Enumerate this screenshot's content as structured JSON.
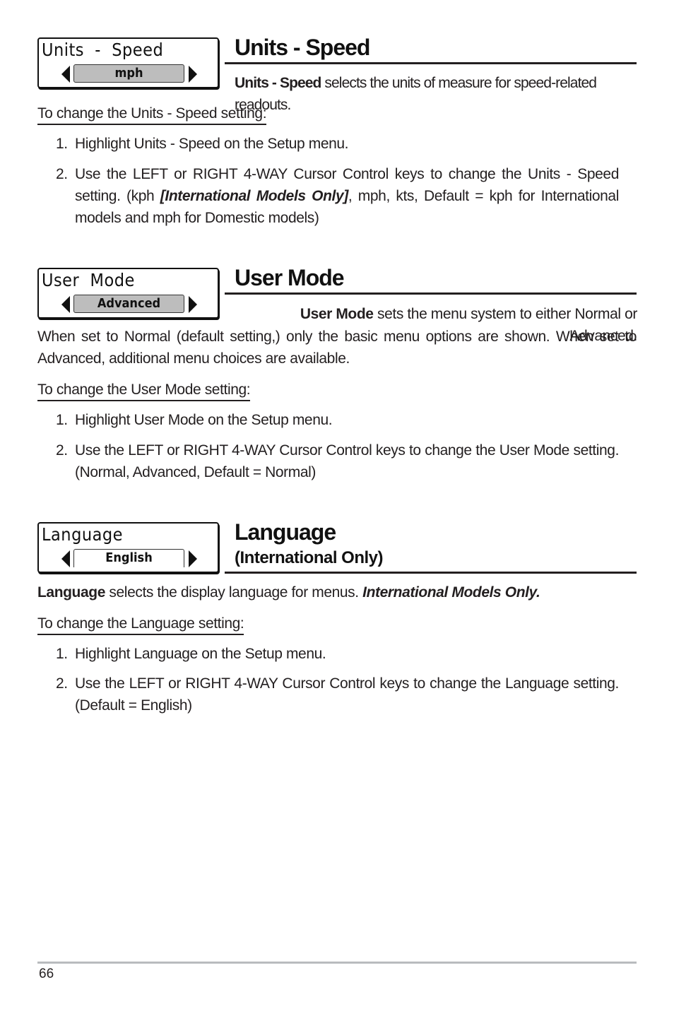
{
  "sections": [
    {
      "widget": {
        "label": "Units  -  Speed",
        "value": "mph",
        "left_arrow_icon": "triangle-left",
        "right_arrow_icon": "triangle-right"
      },
      "title": "Units - Speed",
      "intro_bold": "Units - Speed",
      "intro_rest": " selects the units of measure for speed-related readouts.",
      "procedure_heading": "To change the Units - Speed setting:",
      "steps": [
        {
          "num": "1.",
          "text": "Highlight Units - Speed on the Setup menu."
        },
        {
          "num": "2.",
          "text_before": "Use the LEFT or RIGHT 4-WAY Cursor Control keys to change the Units - Speed setting. (kph ",
          "text_italic": "[International Models Only]",
          "text_after": ", mph, kts, Default = kph for International models and mph for Domestic models)"
        }
      ]
    },
    {
      "widget": {
        "label": "User  Mode",
        "value": "Advanced",
        "left_arrow_icon": "triangle-left",
        "right_arrow_icon": "triangle-right"
      },
      "title": "User Mode",
      "intro_bold": "User Mode",
      "intro_rest": " sets the menu system to either Normal or Advanced.",
      "intro_continued": "When set to Normal (default setting,) only the basic menu options are shown.  When set to Advanced, additional menu choices are available.",
      "procedure_heading": "To change the User Mode setting:",
      "steps": [
        {
          "num": "1.",
          "text": "Highlight User Mode on the Setup menu."
        },
        {
          "num": "2.",
          "text": "Use the LEFT or RIGHT 4-WAY Cursor Control keys to change the User Mode setting. (Normal, Advanced, Default = Normal)"
        }
      ]
    },
    {
      "widget": {
        "label": "Language",
        "value": "English",
        "left_arrow_icon": "triangle-left",
        "right_arrow_icon": "triangle-right"
      },
      "title": "Language",
      "subtitle": "(International Only)",
      "intro_bold": "Language",
      "intro_rest": " selects the display language for menus. ",
      "intro_italic": "International Models Only.",
      "procedure_heading": "To change the Language setting:",
      "steps": [
        {
          "num": "1.",
          "text": "Highlight Language on the Setup menu."
        },
        {
          "num": "2.",
          "text": "Use the LEFT or RIGHT 4-WAY Cursor Control keys to change the Language setting. (Default = English)"
        }
      ]
    }
  ],
  "footer": {
    "page_number": "66"
  },
  "colors": {
    "text": "#231f20",
    "widget_value_bg": "#bdbdbd",
    "footer_rule": "#b9bbbe"
  }
}
